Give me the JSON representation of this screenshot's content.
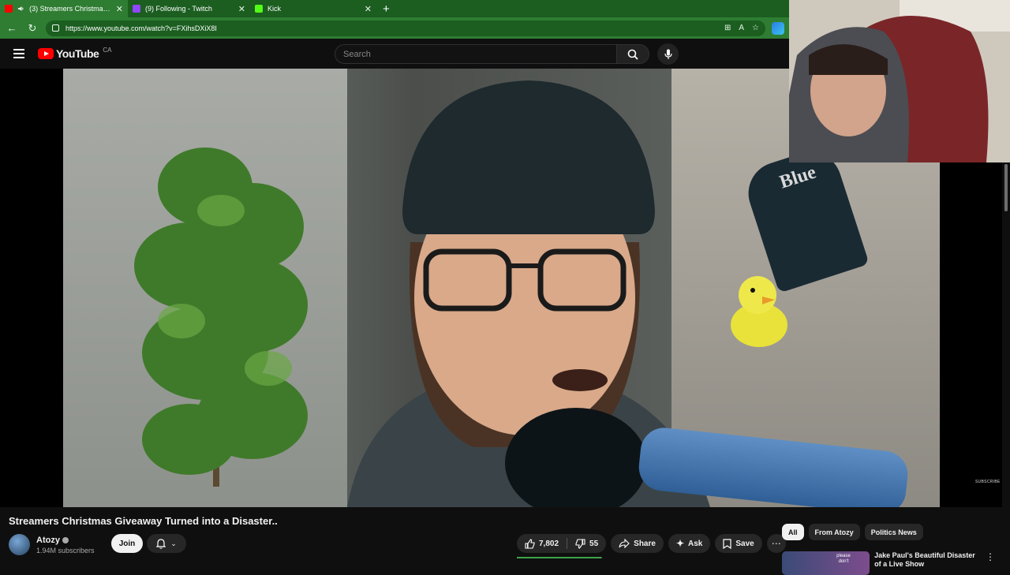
{
  "browser": {
    "tabs": [
      {
        "title": "(3) Streamers Christmas Giv",
        "favicon_color": "#ff0000",
        "active": true,
        "audio_icon": "speaker-icon"
      },
      {
        "title": "(9) Following - Twitch",
        "favicon_color": "#9146ff",
        "active": false
      },
      {
        "title": "Kick",
        "favicon_color": "#53fc18",
        "active": false
      }
    ],
    "new_tab_label": "+",
    "url": "https://www.youtube.com/watch?v=FXihsDXiX8I",
    "accent": "#2e7d32"
  },
  "masthead": {
    "logo_text": "YouTube",
    "region": "CA",
    "search_placeholder": "Search"
  },
  "player": {
    "brand_text": "Blue",
    "watermark": "SUBSCRIBE"
  },
  "video": {
    "title": "Streamers Christmas Giveaway Turned into a Disaster..",
    "channel": "Atozy",
    "subscribers": "1.94M subscribers",
    "join_label": "Join",
    "likes": "7,802",
    "dislikes": "55",
    "like_ratio": 0.993,
    "share_label": "Share",
    "ask_label": "Ask",
    "save_label": "Save"
  },
  "sidebar": {
    "chips": [
      {
        "label": "All",
        "active": true
      },
      {
        "label": "From Atozy",
        "active": false
      },
      {
        "label": "Politics News",
        "active": false
      }
    ],
    "recommendations": [
      {
        "title": "Jake Paul's Beautiful Disaster of a Live Show",
        "thumb_text": "please don't"
      }
    ]
  }
}
